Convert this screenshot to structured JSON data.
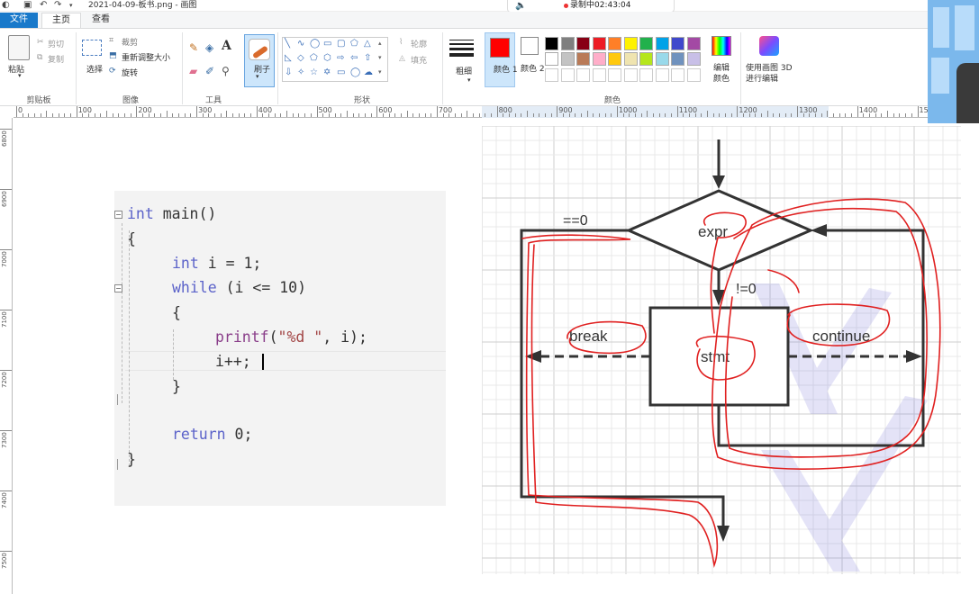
{
  "window": {
    "title": "2021-04-09-板书.png - 画图",
    "qat_icons": [
      "save-icon",
      "undo-icon",
      "redo-icon",
      "dropdown-icon"
    ]
  },
  "recording": {
    "status": "录制中02:43:04"
  },
  "tabs": [
    {
      "label": "文件"
    },
    {
      "label": "主页"
    },
    {
      "label": "查看"
    }
  ],
  "ribbon": {
    "clipboard": {
      "paste": "粘贴",
      "cut": "剪切",
      "copy": "复制",
      "group": "剪贴板"
    },
    "image": {
      "select": "选择",
      "crop": "裁剪",
      "resize": "重新调整大小",
      "rotate": "旋转",
      "group": "图像"
    },
    "tools": {
      "group": "工具",
      "brush": "刷子"
    },
    "shapes": {
      "outline": "轮廓",
      "fill": "填充",
      "group": "形状"
    },
    "size": {
      "label": "粗细"
    },
    "color1": {
      "label": "颜色 1"
    },
    "color2": {
      "label": "颜色 2"
    },
    "colors": {
      "group": "颜色",
      "edit": "编辑颜色"
    },
    "paint3d": {
      "label": "使用画图 3D 进行编辑"
    },
    "palette_row1": [
      "#000000",
      "#7f7f7f",
      "#880015",
      "#ed1c24",
      "#ff7f27",
      "#fff200",
      "#22b14c",
      "#00a2e8",
      "#3f48cc",
      "#a349a4"
    ],
    "palette_row2": [
      "#ffffff",
      "#c3c3c3",
      "#b97a57",
      "#ffaec9",
      "#ffc90e",
      "#efe4b0",
      "#b5e61d",
      "#99d9ea",
      "#7092be",
      "#c8bfe7"
    ]
  },
  "ruler": {
    "h_ticks": [
      "0",
      "100",
      "200",
      "300",
      "400",
      "500",
      "600",
      "700",
      "800",
      "900",
      "1000",
      "1100",
      "1200",
      "1300",
      "1400",
      "15"
    ],
    "v_ticks": [
      "6800",
      "6900",
      "7000",
      "7100",
      "7200",
      "7300",
      "7400",
      "7500"
    ]
  },
  "code": {
    "lines": [
      {
        "kw": "int",
        "rest": " main()"
      },
      {
        "text": "{"
      },
      {
        "kw": "int",
        "rest": " i = 1;"
      },
      {
        "kw": "while",
        "rest": " (i <= 10)"
      },
      {
        "text": "{"
      },
      {
        "fn": "printf",
        "p1": "(",
        "str": "\"%d \"",
        "p2": ", i);"
      },
      {
        "text": "i++;"
      },
      {
        "text": "}"
      },
      {
        "kw": "return",
        "rest": " 0;"
      },
      {
        "text": "}"
      }
    ]
  },
  "diagram": {
    "expr": "expr",
    "eq0": "==0",
    "neq0": "!=0",
    "stmt": "stmt",
    "break": "break",
    "continue": "continue",
    "annotation_color": "#e02020"
  }
}
